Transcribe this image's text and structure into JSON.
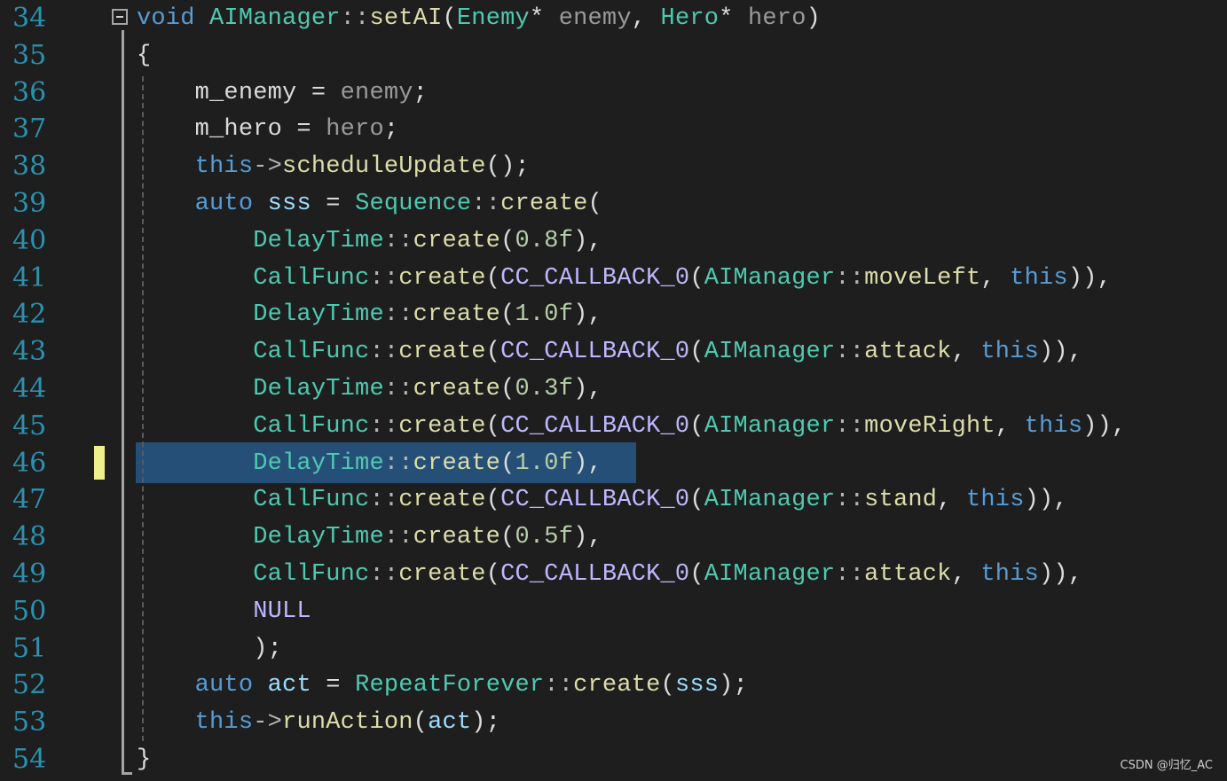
{
  "editor": {
    "lines": [
      {
        "num": "34",
        "tokens": [
          {
            "t": "void",
            "c": "kw"
          },
          {
            "t": " ",
            "c": "df"
          },
          {
            "t": "AIManager",
            "c": "ty"
          },
          {
            "t": "::",
            "c": "pu"
          },
          {
            "t": "setAI",
            "c": "fn"
          },
          {
            "t": "(",
            "c": "df"
          },
          {
            "t": "Enemy",
            "c": "ty"
          },
          {
            "t": "*",
            "c": "df"
          },
          {
            "t": " enemy",
            "c": "pm"
          },
          {
            "t": ", ",
            "c": "df"
          },
          {
            "t": "Hero",
            "c": "ty"
          },
          {
            "t": "*",
            "c": "df"
          },
          {
            "t": " hero",
            "c": "pm"
          },
          {
            "t": ")",
            "c": "df"
          }
        ]
      },
      {
        "num": "35",
        "tokens": [
          {
            "t": "{",
            "c": "df"
          }
        ]
      },
      {
        "num": "36",
        "tokens": [
          {
            "t": "    m_enemy",
            "c": "mb"
          },
          {
            "t": " = ",
            "c": "df"
          },
          {
            "t": "enemy",
            "c": "pm"
          },
          {
            "t": ";",
            "c": "df"
          }
        ]
      },
      {
        "num": "37",
        "tokens": [
          {
            "t": "    m_hero",
            "c": "mb"
          },
          {
            "t": " = ",
            "c": "df"
          },
          {
            "t": "hero",
            "c": "pm"
          },
          {
            "t": ";",
            "c": "df"
          }
        ]
      },
      {
        "num": "38",
        "tokens": [
          {
            "t": "    this",
            "c": "kw"
          },
          {
            "t": "->",
            "c": "pu"
          },
          {
            "t": "scheduleUpdate",
            "c": "fn"
          },
          {
            "t": "();",
            "c": "df"
          }
        ]
      },
      {
        "num": "39",
        "tokens": [
          {
            "t": "    auto",
            "c": "kw"
          },
          {
            "t": " ",
            "c": "df"
          },
          {
            "t": "sss",
            "c": "lv"
          },
          {
            "t": " = ",
            "c": "df"
          },
          {
            "t": "Sequence",
            "c": "ty"
          },
          {
            "t": "::",
            "c": "pu"
          },
          {
            "t": "create",
            "c": "fn"
          },
          {
            "t": "(",
            "c": "df"
          }
        ]
      },
      {
        "num": "40",
        "tokens": [
          {
            "t": "        DelayTime",
            "c": "ty"
          },
          {
            "t": "::",
            "c": "pu"
          },
          {
            "t": "create",
            "c": "fn"
          },
          {
            "t": "(",
            "c": "df"
          },
          {
            "t": "0.8f",
            "c": "nm"
          },
          {
            "t": "),",
            "c": "df"
          }
        ]
      },
      {
        "num": "41",
        "tokens": [
          {
            "t": "        CallFunc",
            "c": "ty"
          },
          {
            "t": "::",
            "c": "pu"
          },
          {
            "t": "create",
            "c": "fn"
          },
          {
            "t": "(",
            "c": "df"
          },
          {
            "t": "CC_CALLBACK_0",
            "c": "mc"
          },
          {
            "t": "(",
            "c": "df"
          },
          {
            "t": "AIManager",
            "c": "ty"
          },
          {
            "t": "::",
            "c": "pu"
          },
          {
            "t": "moveLeft",
            "c": "fn"
          },
          {
            "t": ", ",
            "c": "df"
          },
          {
            "t": "this",
            "c": "kw"
          },
          {
            "t": ")),",
            "c": "df"
          }
        ]
      },
      {
        "num": "42",
        "tokens": [
          {
            "t": "        DelayTime",
            "c": "ty"
          },
          {
            "t": "::",
            "c": "pu"
          },
          {
            "t": "create",
            "c": "fn"
          },
          {
            "t": "(",
            "c": "df"
          },
          {
            "t": "1.0f",
            "c": "nm"
          },
          {
            "t": "),",
            "c": "df"
          }
        ]
      },
      {
        "num": "43",
        "tokens": [
          {
            "t": "        CallFunc",
            "c": "ty"
          },
          {
            "t": "::",
            "c": "pu"
          },
          {
            "t": "create",
            "c": "fn"
          },
          {
            "t": "(",
            "c": "df"
          },
          {
            "t": "CC_CALLBACK_0",
            "c": "mc"
          },
          {
            "t": "(",
            "c": "df"
          },
          {
            "t": "AIManager",
            "c": "ty"
          },
          {
            "t": "::",
            "c": "pu"
          },
          {
            "t": "attack",
            "c": "fn"
          },
          {
            "t": ", ",
            "c": "df"
          },
          {
            "t": "this",
            "c": "kw"
          },
          {
            "t": ")),",
            "c": "df"
          }
        ]
      },
      {
        "num": "44",
        "tokens": [
          {
            "t": "        DelayTime",
            "c": "ty"
          },
          {
            "t": "::",
            "c": "pu"
          },
          {
            "t": "create",
            "c": "fn"
          },
          {
            "t": "(",
            "c": "df"
          },
          {
            "t": "0.3f",
            "c": "nm"
          },
          {
            "t": "),",
            "c": "df"
          }
        ]
      },
      {
        "num": "45",
        "tokens": [
          {
            "t": "        CallFunc",
            "c": "ty"
          },
          {
            "t": "::",
            "c": "pu"
          },
          {
            "t": "create",
            "c": "fn"
          },
          {
            "t": "(",
            "c": "df"
          },
          {
            "t": "CC_CALLBACK_0",
            "c": "mc"
          },
          {
            "t": "(",
            "c": "df"
          },
          {
            "t": "AIManager",
            "c": "ty"
          },
          {
            "t": "::",
            "c": "pu"
          },
          {
            "t": "moveRight",
            "c": "fn"
          },
          {
            "t": ", ",
            "c": "df"
          },
          {
            "t": "this",
            "c": "kw"
          },
          {
            "t": ")),",
            "c": "df"
          }
        ]
      },
      {
        "num": "46",
        "tokens": [
          {
            "t": "        DelayTime",
            "c": "ty"
          },
          {
            "t": "::",
            "c": "pu"
          },
          {
            "t": "create",
            "c": "fn"
          },
          {
            "t": "(",
            "c": "df"
          },
          {
            "t": "1.0f",
            "c": "nm"
          },
          {
            "t": "),",
            "c": "df"
          }
        ]
      },
      {
        "num": "47",
        "tokens": [
          {
            "t": "        CallFunc",
            "c": "ty"
          },
          {
            "t": "::",
            "c": "pu"
          },
          {
            "t": "create",
            "c": "fn"
          },
          {
            "t": "(",
            "c": "df"
          },
          {
            "t": "CC_CALLBACK_0",
            "c": "mc"
          },
          {
            "t": "(",
            "c": "df"
          },
          {
            "t": "AIManager",
            "c": "ty"
          },
          {
            "t": "::",
            "c": "pu"
          },
          {
            "t": "stand",
            "c": "fn"
          },
          {
            "t": ", ",
            "c": "df"
          },
          {
            "t": "this",
            "c": "kw"
          },
          {
            "t": ")),",
            "c": "df"
          }
        ]
      },
      {
        "num": "48",
        "tokens": [
          {
            "t": "        DelayTime",
            "c": "ty"
          },
          {
            "t": "::",
            "c": "pu"
          },
          {
            "t": "create",
            "c": "fn"
          },
          {
            "t": "(",
            "c": "df"
          },
          {
            "t": "0.5f",
            "c": "nm"
          },
          {
            "t": "),",
            "c": "df"
          }
        ]
      },
      {
        "num": "49",
        "tokens": [
          {
            "t": "        CallFunc",
            "c": "ty"
          },
          {
            "t": "::",
            "c": "pu"
          },
          {
            "t": "create",
            "c": "fn"
          },
          {
            "t": "(",
            "c": "df"
          },
          {
            "t": "CC_CALLBACK_0",
            "c": "mc"
          },
          {
            "t": "(",
            "c": "df"
          },
          {
            "t": "AIManager",
            "c": "ty"
          },
          {
            "t": "::",
            "c": "pu"
          },
          {
            "t": "attack",
            "c": "fn"
          },
          {
            "t": ", ",
            "c": "df"
          },
          {
            "t": "this",
            "c": "kw"
          },
          {
            "t": ")),",
            "c": "df"
          }
        ]
      },
      {
        "num": "50",
        "tokens": [
          {
            "t": "        NULL",
            "c": "mc"
          }
        ]
      },
      {
        "num": "51",
        "tokens": [
          {
            "t": "        );",
            "c": "df"
          }
        ]
      },
      {
        "num": "52",
        "tokens": [
          {
            "t": "    auto",
            "c": "kw"
          },
          {
            "t": " ",
            "c": "df"
          },
          {
            "t": "act",
            "c": "lv"
          },
          {
            "t": " = ",
            "c": "df"
          },
          {
            "t": "RepeatForever",
            "c": "ty"
          },
          {
            "t": "::",
            "c": "pu"
          },
          {
            "t": "create",
            "c": "fn"
          },
          {
            "t": "(",
            "c": "df"
          },
          {
            "t": "sss",
            "c": "lv"
          },
          {
            "t": ");",
            "c": "df"
          }
        ]
      },
      {
        "num": "53",
        "tokens": [
          {
            "t": "    this",
            "c": "kw"
          },
          {
            "t": "->",
            "c": "pu"
          },
          {
            "t": "runAction",
            "c": "fn"
          },
          {
            "t": "(",
            "c": "df"
          },
          {
            "t": "act",
            "c": "lv"
          },
          {
            "t": ");",
            "c": "df"
          }
        ]
      },
      {
        "num": "54",
        "tokens": [
          {
            "t": "}",
            "c": "df"
          }
        ]
      }
    ],
    "highlighted_line": "46"
  },
  "colors": {
    "background": "#1e1e1e",
    "line_number": "#2b91af",
    "selection": "#264f78",
    "change_marker": "#efef8c"
  },
  "watermark": "CSDN @归忆_AC"
}
